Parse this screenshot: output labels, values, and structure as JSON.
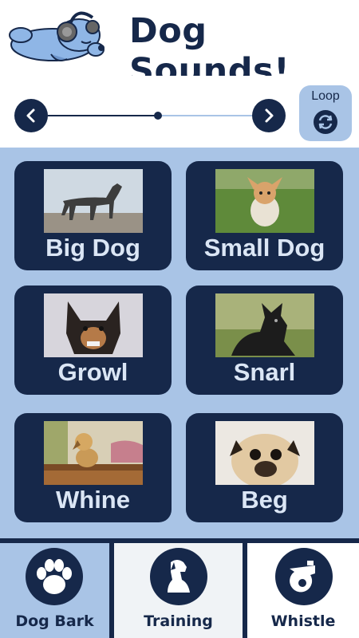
{
  "app": {
    "title": "Dog Sounds!"
  },
  "player": {
    "loop_label": "Loop",
    "progress": 0.54
  },
  "sounds": [
    {
      "label": "Big Dog"
    },
    {
      "label": "Small Dog"
    },
    {
      "label": "Growl"
    },
    {
      "label": "Snarl"
    },
    {
      "label": "Whine"
    },
    {
      "label": "Beg"
    }
  ],
  "tabs": [
    {
      "label": "Dog Bark",
      "selected": true
    },
    {
      "label": "Training",
      "selected": false
    },
    {
      "label": "Whistle",
      "selected": false
    }
  ],
  "colors": {
    "navy": "#16284a",
    "light_blue": "#a9c4e6",
    "tile_text": "#dbe6f5"
  }
}
